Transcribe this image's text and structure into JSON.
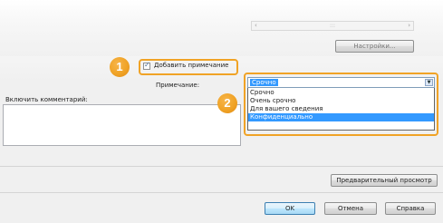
{
  "options_dialog": {
    "settings_label": "Настройки...",
    "add_note_label": "Добавить примечание",
    "add_note_checked": true,
    "note_label": "Примечание:",
    "comment_label": "Включить комментарий:",
    "comment_value": "",
    "note_select": {
      "selected": "Срочно",
      "options": [
        "Срочно",
        "Очень срочно",
        "Для вашего сведения",
        "Конфиденциально"
      ],
      "highlighted_index": 3
    },
    "preview_label": "Предварительный просмотр",
    "ok_label": "OK",
    "cancel_label": "Отмена",
    "help_label": "Справка"
  },
  "callouts": [
    "1",
    "2"
  ],
  "colors": {
    "callout": "#f0a326",
    "selection": "#3399ff",
    "dialog_bg": "#f0f0f0"
  }
}
